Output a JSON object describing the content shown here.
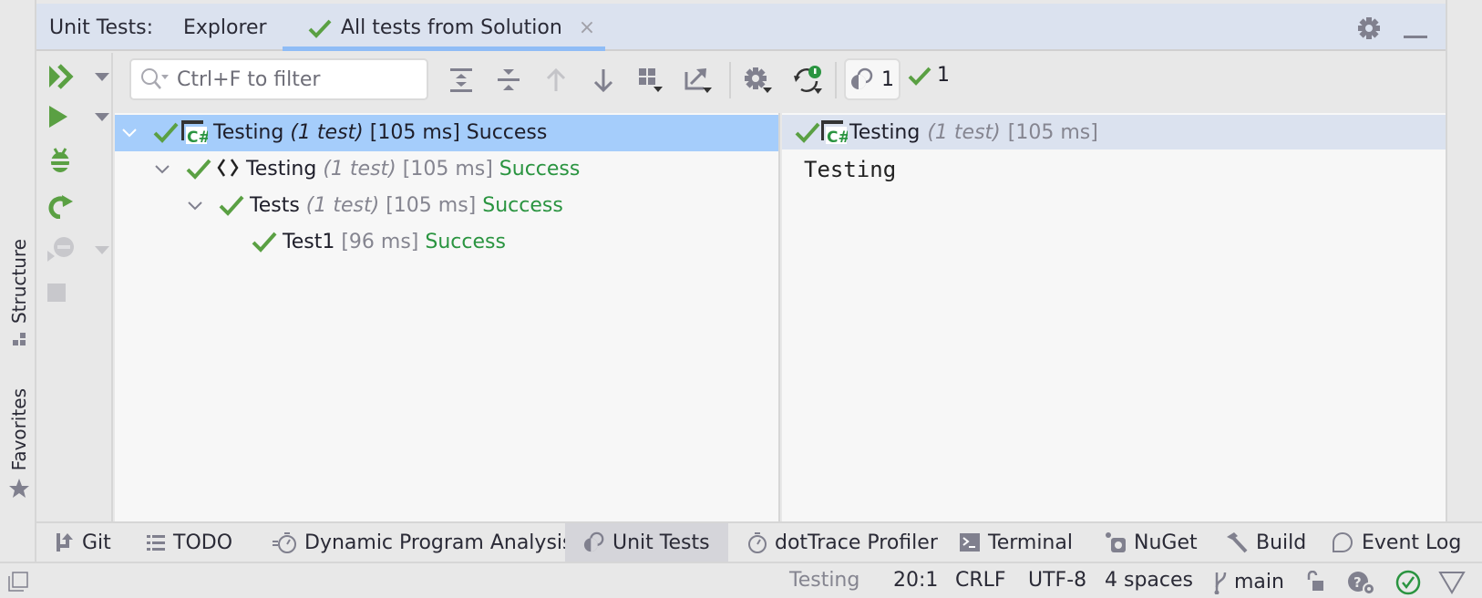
{
  "header": {
    "title": "Unit Tests:",
    "tabs": [
      {
        "label": "Explorer",
        "icon": "none"
      },
      {
        "label": "All tests from Solution",
        "icon": "check-icon",
        "active": true,
        "closable": true
      }
    ],
    "close_glyph": "×",
    "actions": [
      "gear-icon",
      "minimize-icon"
    ]
  },
  "left_strip": {
    "items": [
      {
        "label": "Structure",
        "icon": "structure-icon"
      },
      {
        "label": "Favorites",
        "icon": "star-icon"
      }
    ]
  },
  "vertical_toolbar": {
    "items": [
      "run-all-icon",
      "run-icon",
      "debug-icon",
      "rerun-icon",
      "cover-icon",
      "stop-icon"
    ]
  },
  "toolbar": {
    "filter_placeholder": "Ctrl+F to filter",
    "filter_value": "",
    "buttons": [
      "expand-all-icon",
      "collapse-all-icon",
      "previous-icon",
      "next-icon",
      "group-by-icon",
      "export-icon",
      "settings-icon",
      "auto-run-icon"
    ],
    "total_count": "1",
    "passed_count": "1"
  },
  "tree": {
    "rows": [
      {
        "name": "Testing",
        "count": "(1 test)",
        "duration": "[105 ms]",
        "status": "Success",
        "kind": "project"
      },
      {
        "name": "Testing",
        "count": "(1 test)",
        "duration": "[105 ms]",
        "status": "Success",
        "kind": "namespace",
        "icon_glyph": "⟨⟩"
      },
      {
        "name": "Tests",
        "count": "(1 test)",
        "duration": "[105 ms]",
        "status": "Success",
        "kind": "class"
      },
      {
        "name": "Test1",
        "count": "",
        "duration": "[96 ms]",
        "status": "Success",
        "kind": "test"
      }
    ]
  },
  "details": {
    "name": "Testing",
    "count": "(1 test)",
    "duration": "[105 ms]",
    "output": "Testing"
  },
  "bottom_tabs": [
    {
      "label": "Git",
      "icon": "git-icon"
    },
    {
      "label": "TODO",
      "icon": "list-icon"
    },
    {
      "label": "Dynamic Program Analysis",
      "icon": "dpa-icon"
    },
    {
      "label": "Unit Tests",
      "icon": "unit-tests-icon",
      "active": true
    },
    {
      "label": "dotTrace Profiler",
      "icon": "stopwatch-icon"
    },
    {
      "label": "Terminal",
      "icon": "terminal-icon"
    },
    {
      "label": "NuGet",
      "icon": "nuget-icon"
    },
    {
      "label": "Build",
      "icon": "hammer-icon"
    },
    {
      "label": "Event Log",
      "icon": "event-log-icon"
    }
  ],
  "status_bar": {
    "context": "Testing",
    "position": "20:1",
    "line_ending": "CRLF",
    "encoding": "UTF-8",
    "indent": "4 spaces",
    "branch": "main"
  },
  "colors": {
    "accent_green": "#5aa043",
    "success_text": "#2a9440",
    "selection": "#a5cdfb",
    "header_bg": "#dbe2ef",
    "tab_underline": "#8fbcf6"
  }
}
